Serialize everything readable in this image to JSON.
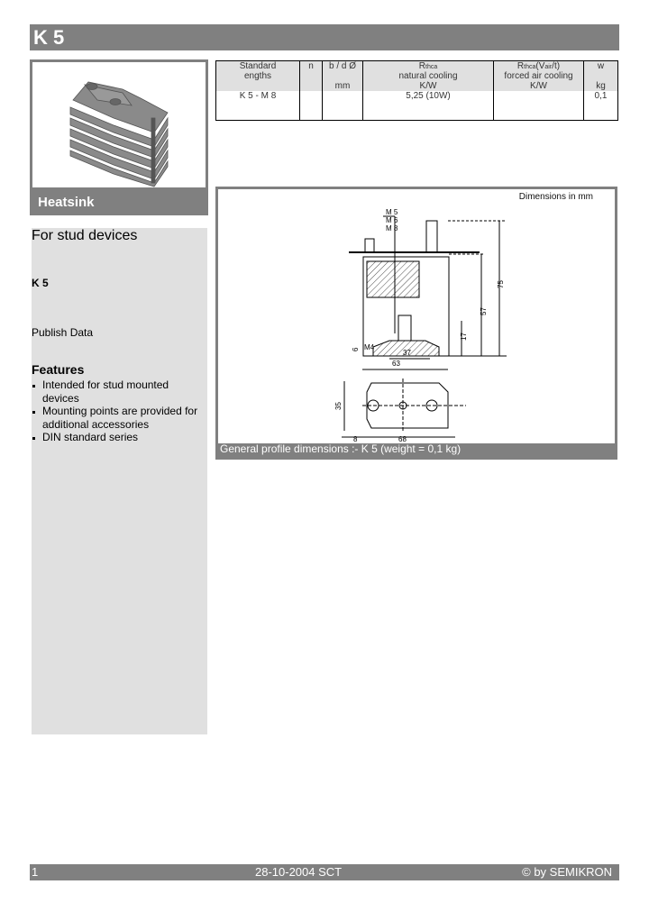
{
  "header": {
    "title": "K 5"
  },
  "product_image": {
    "caption": "Heatsink",
    "icon": "heatsink-image"
  },
  "left_panel": {
    "subtitle": "For stud devices",
    "product_code": "K 5",
    "publish_label": "Publish Data",
    "features_title": "Features",
    "features": [
      "Intended for stud mounted devices",
      "Mounting points are provided for additional accessories",
      "DIN standard series"
    ]
  },
  "spec_table": {
    "headers": [
      {
        "line1": "Standard",
        "line2": "engths",
        "unit": ""
      },
      {
        "line1": "n",
        "line2": "",
        "unit": ""
      },
      {
        "line1": "b / d Ø",
        "line2": "",
        "unit": "mm"
      },
      {
        "line1": "R",
        "sub": "thca",
        "line2": "natural cooling",
        "unit": "K/W"
      },
      {
        "line1": "R",
        "sub": "thca",
        "extra": "(V",
        "sub2": "air",
        "extra2": "/t)",
        "line2": "forced air cooling",
        "unit": "K/W"
      },
      {
        "line1": "w",
        "line2": "",
        "unit": "kg"
      }
    ],
    "rows": [
      [
        "K 5 - M 8",
        "",
        "",
        "5,25 (10W)",
        "",
        "0,1"
      ]
    ]
  },
  "drawing": {
    "note": "Dimensions in mm",
    "thread_labels": [
      "M 5",
      "M 6",
      "M 8"
    ],
    "dims": {
      "h_total": "75",
      "h_mid": "57",
      "h_low": "17",
      "w_inner": "37",
      "w_total": "63",
      "h_base": "6",
      "screw": "M4",
      "depth": "35",
      "offset": "8",
      "length": "68"
    },
    "caption": "General profile dimensions :- K 5 (weight = 0,1 kg)"
  },
  "footer": {
    "page": "1",
    "date": "28-10-2004  SCT",
    "copyright": "© by SEMIKRON"
  }
}
